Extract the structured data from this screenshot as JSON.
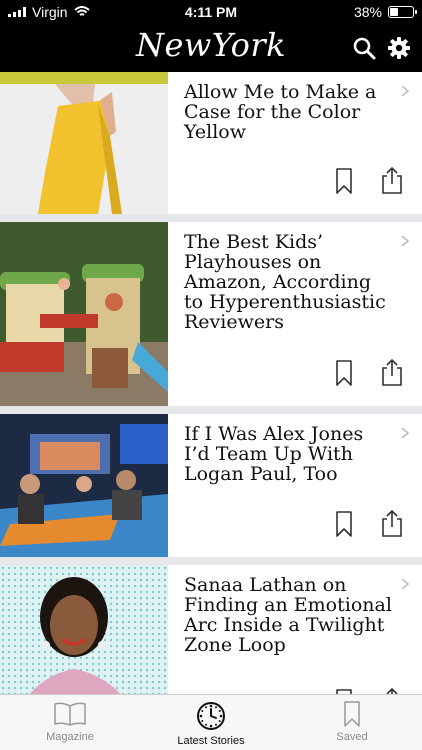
{
  "status": {
    "carrier": "Virgin",
    "time": "4:11 PM",
    "battery": "38%",
    "battery_level": 0.38
  },
  "header": {
    "logo": "NewYork"
  },
  "articles": [
    {
      "title": "Allow Me to Make a Case for the Color Yellow"
    },
    {
      "title": "The Best Kids’ Playhouses on Amazon, According to Hyperenthusiastic Reviewers"
    },
    {
      "title": "If I Was Alex Jones I’d Team Up With Logan Paul, Too"
    },
    {
      "title": "Sanaa Lathan on Finding an Emotional Arc Inside a Twilight Zone Loop"
    }
  ],
  "tabs": [
    {
      "label": "Magazine",
      "icon": "book-icon"
    },
    {
      "label": "Latest Stories",
      "icon": "clock-icon",
      "active": true
    },
    {
      "label": "Saved",
      "icon": "bookmark-icon"
    }
  ],
  "colors": {
    "header_bg": "#000000",
    "divider": "#e5e7ea",
    "tab_active": "#111111",
    "tab_inactive": "#888888"
  }
}
